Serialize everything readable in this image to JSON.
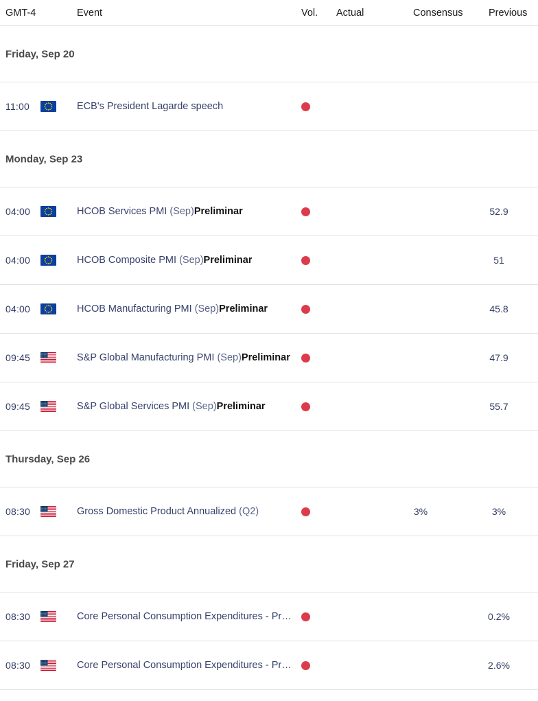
{
  "header": {
    "timezone": "GMT-4",
    "event": "Event",
    "vol": "Vol.",
    "actual": "Actual",
    "consensus": "Consensus",
    "previous": "Previous"
  },
  "colors": {
    "volatility_high": "#dd3b4b",
    "event_link": "#36416b",
    "date_header": "#4a4a4a",
    "border": "#e2e2e2"
  },
  "groups": [
    {
      "date": "Friday, Sep 20",
      "rows": [
        {
          "time": "11:00",
          "flag": "eu-flag-icon",
          "event_main": "ECB's President Lagarde speech",
          "event_period": "",
          "event_prelim": "",
          "volatility": "high",
          "actual": "",
          "consensus": "",
          "previous": ""
        }
      ]
    },
    {
      "date": "Monday, Sep 23",
      "rows": [
        {
          "time": "04:00",
          "flag": "eu-flag-icon",
          "event_main": "HCOB Services PMI ",
          "event_period": "(Sep)",
          "event_prelim": "Preliminar",
          "volatility": "high",
          "actual": "",
          "consensus": "",
          "previous": "52.9"
        },
        {
          "time": "04:00",
          "flag": "eu-flag-icon",
          "event_main": "HCOB Composite PMI ",
          "event_period": "(Sep)",
          "event_prelim": "Preliminar",
          "volatility": "high",
          "actual": "",
          "consensus": "",
          "previous": "51"
        },
        {
          "time": "04:00",
          "flag": "eu-flag-icon",
          "event_main": "HCOB Manufacturing PMI ",
          "event_period": "(Sep)",
          "event_prelim": "Preliminar",
          "volatility": "high",
          "actual": "",
          "consensus": "",
          "previous": "45.8"
        },
        {
          "time": "09:45",
          "flag": "us-flag-icon",
          "event_main": "S&P Global Manufacturing PMI ",
          "event_period": "(Sep)",
          "event_prelim": "Preliminar",
          "volatility": "high",
          "actual": "",
          "consensus": "",
          "previous": "47.9"
        },
        {
          "time": "09:45",
          "flag": "us-flag-icon",
          "event_main": "S&P Global Services PMI ",
          "event_period": "(Sep)",
          "event_prelim": "Preliminar",
          "volatility": "high",
          "actual": "",
          "consensus": "",
          "previous": "55.7"
        }
      ]
    },
    {
      "date": "Thursday, Sep 26",
      "rows": [
        {
          "time": "08:30",
          "flag": "us-flag-icon",
          "event_main": "Gross Domestic Product Annualized ",
          "event_period": "(Q2)",
          "event_prelim": "",
          "volatility": "high",
          "actual": "",
          "consensus": "3%",
          "previous": "3%"
        }
      ]
    },
    {
      "date": "Friday, Sep 27",
      "rows": [
        {
          "time": "08:30",
          "flag": "us-flag-icon",
          "event_main": "Core Personal Consumption Expenditures - Pr…",
          "event_period": "",
          "event_prelim": "",
          "volatility": "high",
          "actual": "",
          "consensus": "",
          "previous": "0.2%"
        },
        {
          "time": "08:30",
          "flag": "us-flag-icon",
          "event_main": "Core Personal Consumption Expenditures - Pr…",
          "event_period": "",
          "event_prelim": "",
          "volatility": "high",
          "actual": "",
          "consensus": "",
          "previous": "2.6%"
        }
      ]
    }
  ]
}
